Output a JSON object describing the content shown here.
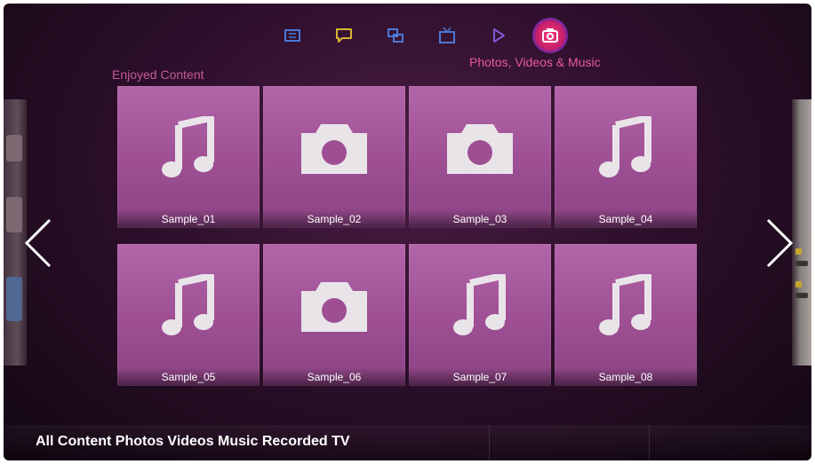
{
  "menu": {
    "icons": [
      "notes-icon",
      "chat-bubble-icon",
      "multi-screen-icon",
      "tv-icon",
      "play-icon",
      "camera-icon"
    ],
    "active_label": "Photos, Videos & Music"
  },
  "section_title": "Enjoyed Content",
  "tiles": [
    {
      "label": "Sample_01",
      "type": "music"
    },
    {
      "label": "Sample_02",
      "type": "photo"
    },
    {
      "label": "Sample_03",
      "type": "photo"
    },
    {
      "label": "Sample_04",
      "type": "music"
    },
    {
      "label": "Sample_05",
      "type": "music"
    },
    {
      "label": "Sample_06",
      "type": "photo"
    },
    {
      "label": "Sample_07",
      "type": "music"
    },
    {
      "label": "Sample_08",
      "type": "music"
    }
  ],
  "bottom_bar": {
    "text": "All Content Photos Videos Music Recorded TV"
  },
  "colors": {
    "accent": "#e75aa0",
    "tile": "#a1549a",
    "icon_blue": "#4a78d8",
    "icon_yellow": "#d9b533",
    "icon_purple": "#7f5ad6"
  }
}
